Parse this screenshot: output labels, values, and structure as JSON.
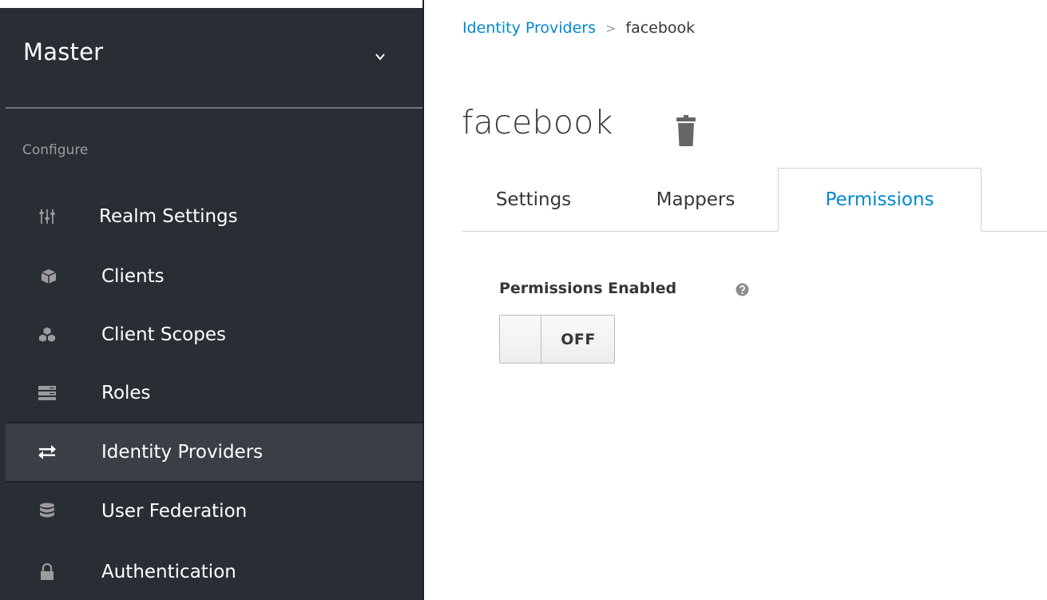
{
  "sidebar": {
    "realm": "Master",
    "section_label": "Configure",
    "items": [
      {
        "label": "Realm Settings",
        "icon": "sliders-icon",
        "active": false
      },
      {
        "label": "Clients",
        "icon": "cube-icon",
        "active": false
      },
      {
        "label": "Client Scopes",
        "icon": "cubes-icon",
        "active": false
      },
      {
        "label": "Roles",
        "icon": "server-icon",
        "active": false
      },
      {
        "label": "Identity Providers",
        "icon": "exchange-icon",
        "active": true
      },
      {
        "label": "User Federation",
        "icon": "database-icon",
        "active": false
      },
      {
        "label": "Authentication",
        "icon": "lock-icon",
        "active": false
      }
    ]
  },
  "breadcrumb": {
    "parent": "Identity Providers",
    "separator": ">",
    "current": "facebook"
  },
  "page": {
    "title": "facebook",
    "delete_icon": "trash-icon"
  },
  "tabs": [
    {
      "label": "Settings",
      "active": false
    },
    {
      "label": "Mappers",
      "active": false
    },
    {
      "label": "Permissions",
      "active": true
    }
  ],
  "permissions": {
    "field_label": "Permissions Enabled",
    "help_icon": "question-circle-icon",
    "toggle_value": "OFF"
  },
  "colors": {
    "sidebar_bg": "#292e34",
    "active_item_bg": "#393f44",
    "link": "#0088ce",
    "text": "#363636"
  }
}
